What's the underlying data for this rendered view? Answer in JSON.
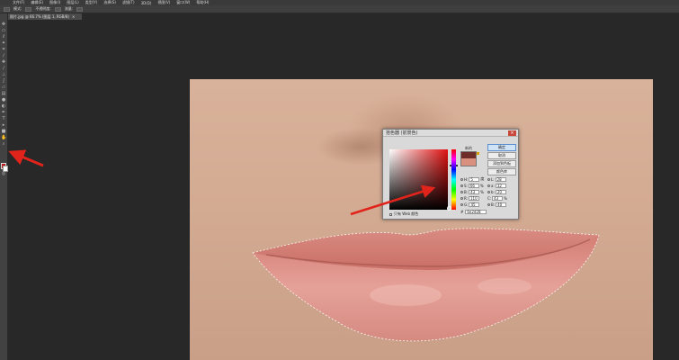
{
  "menubar": {
    "items": [
      "文件(F)",
      "编辑(E)",
      "图像(I)",
      "图层(L)",
      "类型(Y)",
      "选择(S)",
      "滤镜(T)",
      "3D(D)",
      "视图(V)",
      "窗口(W)",
      "帮助(H)"
    ]
  },
  "options": {
    "mode_label": "模式:",
    "opacity_label": "不透明度:",
    "flow_label": "流量:"
  },
  "doc_tab": {
    "label": "照片.jpg @ 66.7% (图层 1, RGB/8)",
    "close": "×"
  },
  "color_picker": {
    "title": "拾色器 (前景色)",
    "close": "×",
    "new_label": "新的",
    "buttons": {
      "ok": "确定",
      "cancel": "取消",
      "add_swatch": "添加到色板",
      "libraries": "颜色库"
    },
    "fields": {
      "H": {
        "label": "H:",
        "value": "5",
        "unit": "度"
      },
      "S": {
        "label": "S:",
        "value": "66",
        "unit": "%"
      },
      "B": {
        "label": "B:",
        "value": "43",
        "unit": "%"
      },
      "R": {
        "label": "R:",
        "value": "110"
      },
      "G": {
        "label": "G:",
        "value": "45"
      },
      "Bl": {
        "label": "B:",
        "value": "40"
      },
      "L": {
        "label": "L:",
        "value": "28"
      },
      "a": {
        "label": "a:",
        "value": "32"
      },
      "b": {
        "label": "b:",
        "value": "20"
      },
      "C": {
        "label": "C:",
        "value": "43",
        "unit": "%"
      },
      "M": {
        "label": "M:",
        "value": "88",
        "unit": "%"
      },
      "Y": {
        "label": "Y:",
        "value": "87",
        "unit": "%"
      },
      "K": {
        "label": "K:",
        "value": "29",
        "unit": "%"
      }
    },
    "hex_label": "#",
    "hex_value": "6e2d28",
    "web_only_label": "只有 Web 颜色"
  },
  "colors": {
    "new_color": "#6e2d28",
    "current_color": "#d9907f",
    "foreground": "#b71a1a",
    "arrow": "#e0241b",
    "accent": "#5d8fcf"
  },
  "icons": [
    "move-icon",
    "marquee-icon",
    "lasso-icon",
    "magic-wand-icon",
    "crop-icon",
    "eyedropper-icon",
    "healing-icon",
    "brush-icon",
    "stamp-icon",
    "history-brush-icon",
    "eraser-icon",
    "gradient-icon",
    "blur-icon",
    "dodge-icon",
    "pen-icon",
    "type-icon",
    "path-select-icon",
    "shape-icon",
    "hand-icon",
    "zoom-icon"
  ]
}
